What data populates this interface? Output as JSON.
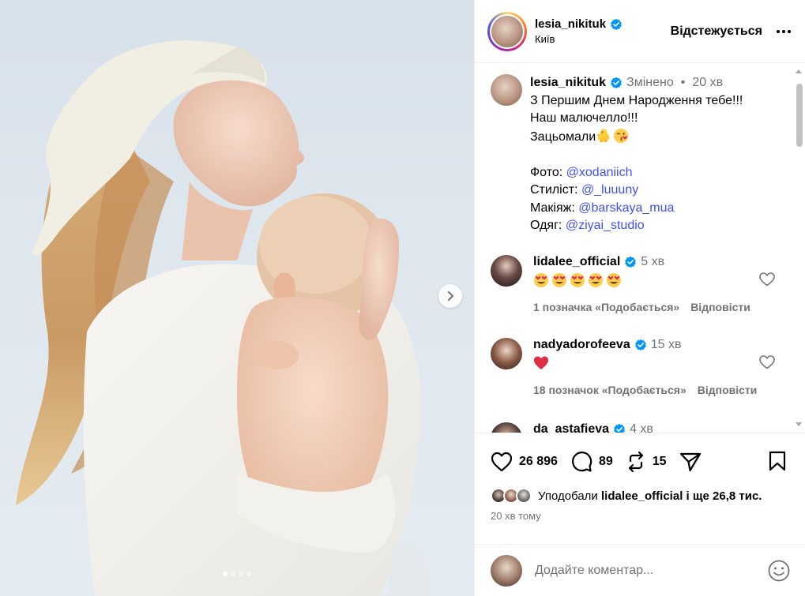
{
  "post": {
    "author": "lesia_nikituk",
    "location": "Київ",
    "follow_label": "Відстежується",
    "more_icon": "more-horizontal-icon",
    "media": {
      "carousel_total": 4,
      "carousel_index": 1
    }
  },
  "caption": {
    "author": "lesia_nikituk",
    "edited": "Змінено",
    "separator": "•",
    "time": "20 хв",
    "line1": "З Першим Днем Народження тебе!!!",
    "line2": "Наш малючелло!!!",
    "line3": "Зацьомали",
    "line3_emojis": [
      "chick-emoji",
      "kissing-face-emoji"
    ],
    "credits": [
      {
        "label": "Фото: ",
        "handle": "@xodaniich"
      },
      {
        "label": "Стиліст: ",
        "handle": "@_luuuny"
      },
      {
        "label": "Макіяж: ",
        "handle": "@barskaya_mua"
      },
      {
        "label": "Одяг: ",
        "handle": "@ziyai_studio"
      }
    ]
  },
  "comments": [
    {
      "author": "lidalee_official",
      "time": "5 хв",
      "emojis": [
        "heart-eyes-emoji",
        "heart-eyes-emoji",
        "heart-eyes-emoji",
        "heart-eyes-emoji",
        "heart-eyes-emoji"
      ],
      "likes": "1 позначка «Подобається»",
      "reply": "Відповісти"
    },
    {
      "author": "nadyadorofeeva",
      "time": "15 хв",
      "emojis": [
        "red-heart-emoji"
      ],
      "likes": "18 позначок «Подобається»",
      "reply": "Відповісти"
    },
    {
      "author": "da_astafieva",
      "time": "4 хв"
    }
  ],
  "actions": {
    "likes": "26 896",
    "comments": "89",
    "reposts": "15"
  },
  "liked_by": {
    "prefix": "Уподобали ",
    "user": "lidalee_official",
    "suffix": " і ще 26,8 тис."
  },
  "timestamp": "20 хв тому",
  "composer": {
    "placeholder": "Додайте коментар..."
  },
  "colors": {
    "link": "#4150f7",
    "verified": "#0095f6",
    "muted": "#737373"
  }
}
